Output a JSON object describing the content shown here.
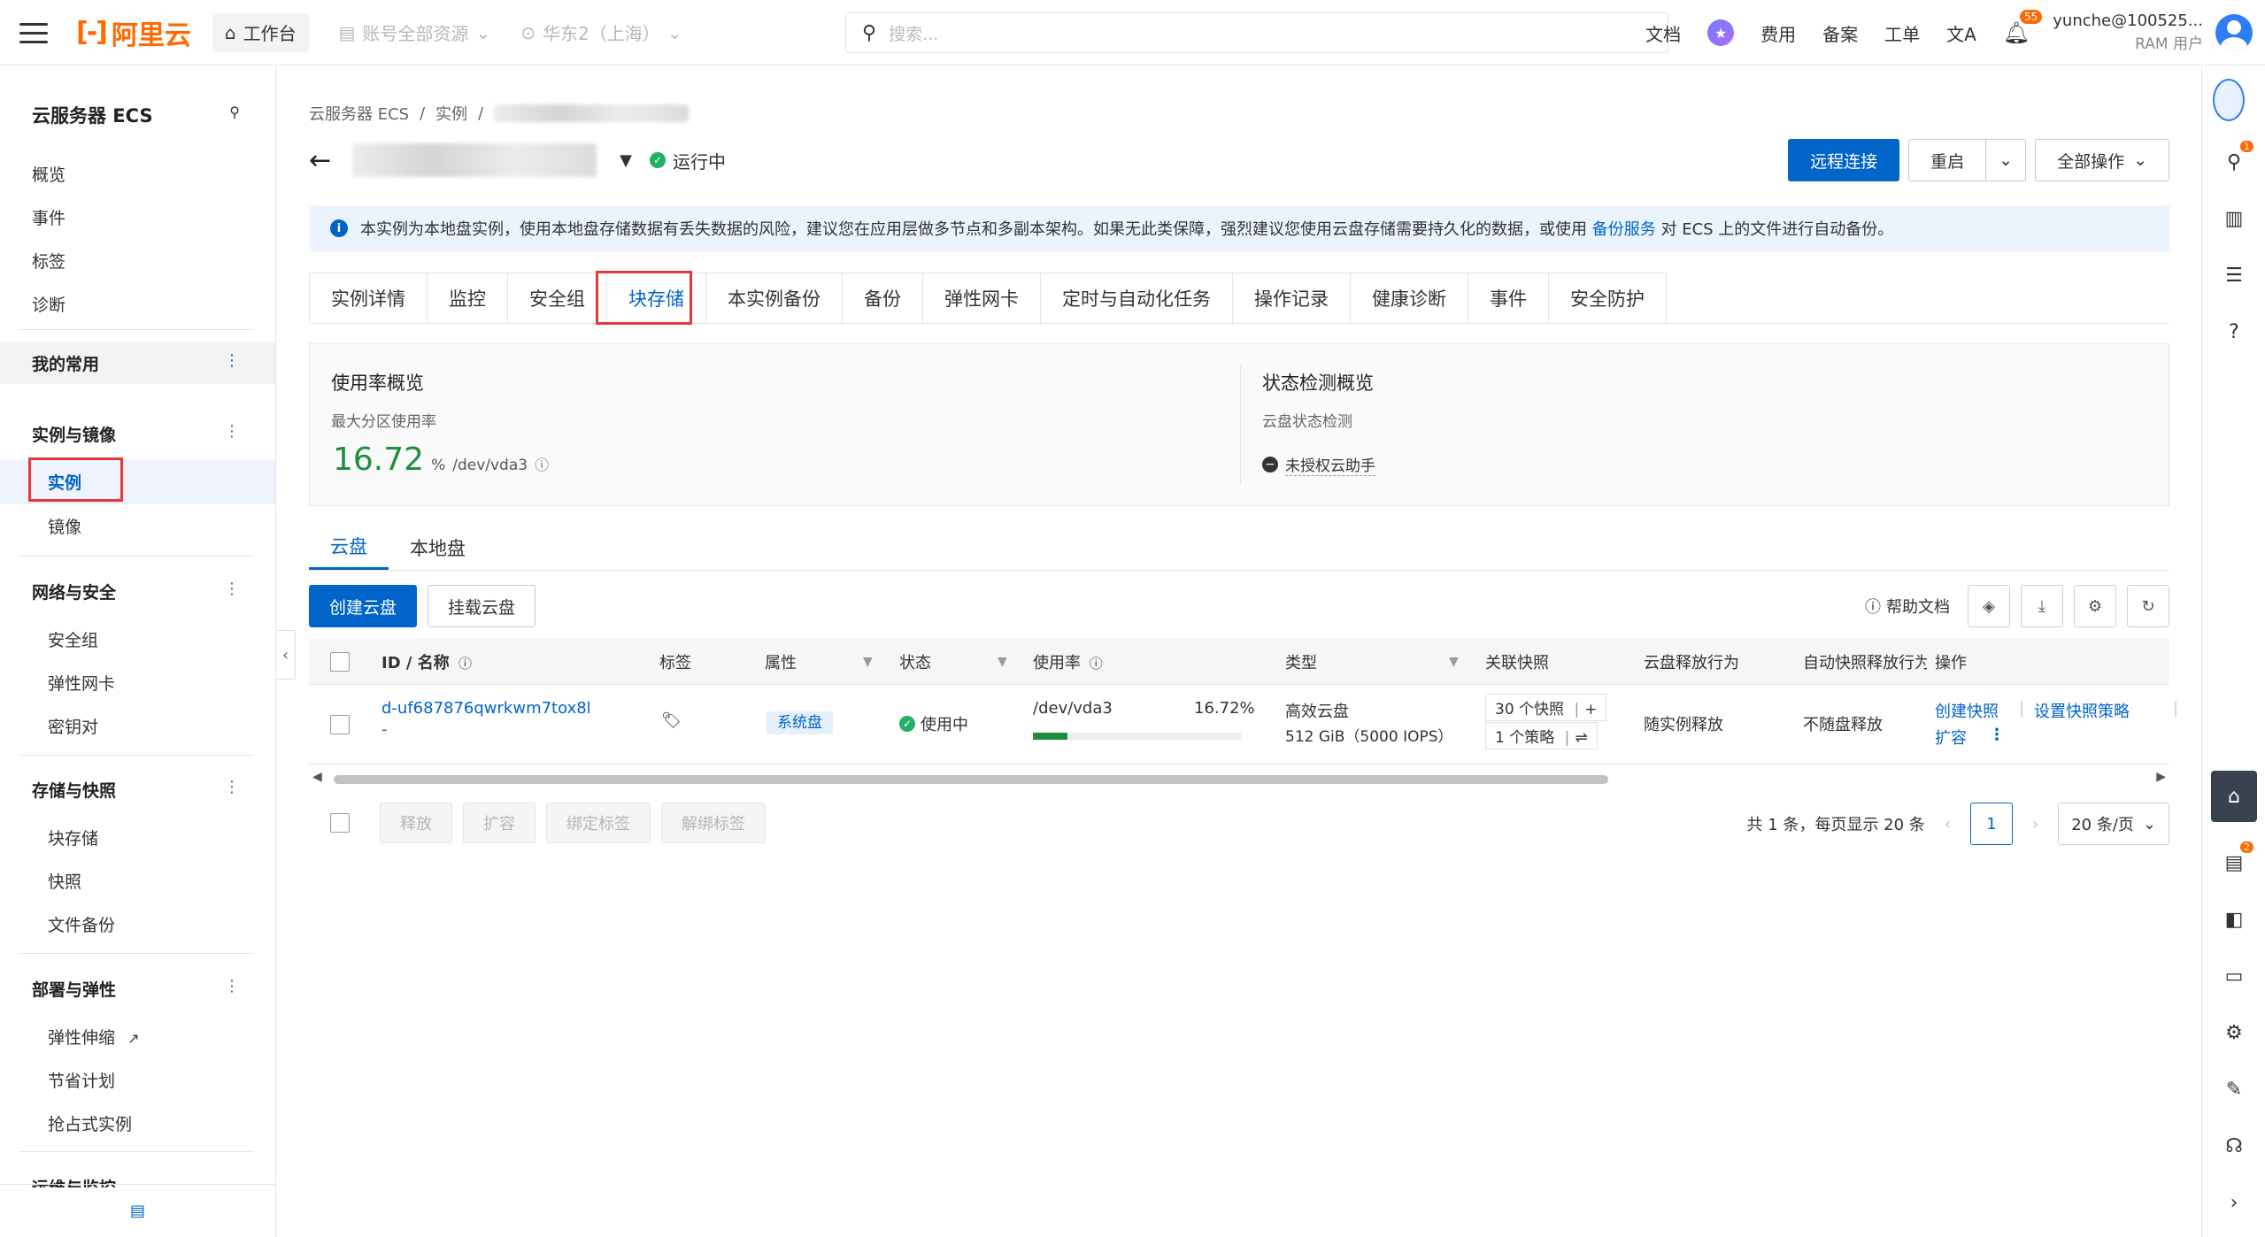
{
  "topnav": {
    "logo_text": "阿里云",
    "workbench": "工作台",
    "resource_scope": "账号全部资源",
    "region": "华东2（上海）",
    "search_placeholder": "搜索...",
    "links": [
      "文档",
      "费用",
      "备案",
      "工单"
    ],
    "notif_count": "55",
    "user_name": "yunche@100525...",
    "user_role": "RAM 用户"
  },
  "sidebar": {
    "title": "云服务器 ECS",
    "top_items": [
      "概览",
      "事件",
      "标签",
      "诊断"
    ],
    "favorites": "我的常用",
    "groups": [
      {
        "label": "实例与镜像",
        "items": [
          "实例",
          "镜像"
        ]
      },
      {
        "label": "网络与安全",
        "items": [
          "安全组",
          "弹性网卡",
          "密钥对"
        ]
      },
      {
        "label": "存储与快照",
        "items": [
          "块存储",
          "快照",
          "文件备份"
        ]
      },
      {
        "label": "部署与弹性",
        "items": [
          "弹性伸缩",
          "节省计划",
          "抢占式实例"
        ]
      },
      {
        "label": "运维与监控",
        "items": []
      }
    ]
  },
  "breadcrumb": [
    "云服务器 ECS",
    "实例"
  ],
  "instance": {
    "status": "运行中"
  },
  "actions": {
    "remote": "远程连接",
    "restart": "重启",
    "all_ops": "全部操作"
  },
  "notice": {
    "text_before": "本实例为本地盘实例，使用本地盘存储数据有丢失数据的风险，建议您在应用层做多节点和多副本架构。如果无此类保障，强烈建议您使用云盘存储需要持久化的数据，或使用",
    "link": "备份服务",
    "text_after": "对 ECS 上的文件进行自动备份。"
  },
  "tabs": [
    "实例详情",
    "监控",
    "安全组",
    "块存储",
    "本实例备份",
    "备份",
    "弹性网卡",
    "定时与自动化任务",
    "操作记录",
    "健康诊断",
    "事件",
    "安全防护"
  ],
  "active_tab": "块存储",
  "overview": {
    "usage_title": "使用率概览",
    "usage_sub": "最大分区使用率",
    "usage_value": "16.72",
    "usage_unit": "%",
    "usage_dev": "/dev/vda3",
    "state_title": "状态检测概览",
    "state_sub": "云盘状态检测",
    "state_value": "未授权云助手"
  },
  "subtabs": [
    "云盘",
    "本地盘"
  ],
  "toolbar": {
    "create": "创建云盘",
    "attach": "挂载云盘",
    "help": "帮助文档"
  },
  "table": {
    "headers": [
      "ID / 名称",
      "标签",
      "属性",
      "状态",
      "使用率",
      "类型",
      "关联快照",
      "云盘释放行为",
      "自动快照释放行为",
      "操作"
    ],
    "rows": [
      {
        "id": "d-uf687876qwrkwm7tox8l",
        "name": "-",
        "attr": "系统盘",
        "status": "使用中",
        "usage_dev": "/dev/vda3",
        "usage_pct": "16.72%",
        "usage_fraction": 0.1672,
        "type": "高效云盘",
        "size": "512 GiB（5000 IOPS）",
        "snapshots": "30 个快照",
        "policies": "1 个策略",
        "release": "随实例释放",
        "auto_snap_release": "不随盘释放",
        "ops": [
          "创建快照",
          "设置快照策略",
          "扩容"
        ]
      }
    ]
  },
  "bulk": [
    "释放",
    "扩容",
    "绑定标签",
    "解绑标签"
  ],
  "pager": {
    "summary": "共 1 条，每页显示 20 条",
    "page": "1",
    "page_size": "20 条/页"
  }
}
